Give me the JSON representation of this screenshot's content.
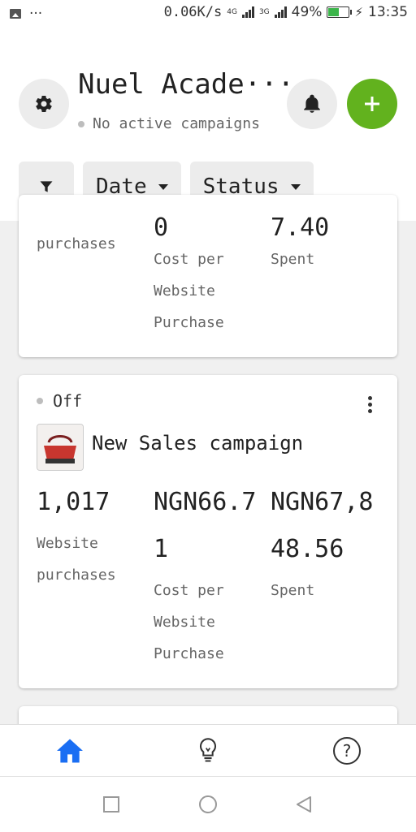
{
  "status_bar": {
    "notification_dots": "···",
    "speed": "0.06K/s",
    "net1": "4G",
    "net2": "3G",
    "battery": "49%",
    "time": "13:35"
  },
  "header": {
    "account_name": "Nuel Acade···",
    "subtitle": "No active campaigns",
    "add_icon": "plus-icon"
  },
  "filters": {
    "date_label": "Date",
    "status_label": "Status"
  },
  "cards": [
    {
      "metrics": [
        {
          "value": "0",
          "label_lines": [
            "purchases"
          ]
        },
        {
          "value": "",
          "label_lines": [
            "Cost per",
            "Website",
            "Purchase"
          ]
        },
        {
          "value": "7.40",
          "label_lines": [
            "Spent"
          ]
        }
      ]
    },
    {
      "status": "Off",
      "campaign_name": "New Sales campaign",
      "metrics": [
        {
          "value_lines": [
            "1,017"
          ],
          "label_lines": [
            "Website",
            "purchases"
          ]
        },
        {
          "value_lines": [
            "NGN66.7",
            "1"
          ],
          "label_lines": [
            "Cost per",
            "Website",
            "Purchase"
          ]
        },
        {
          "value_lines": [
            "NGN67,8",
            "48.56"
          ],
          "label_lines": [
            "Spent"
          ]
        }
      ]
    }
  ],
  "bottom_nav": {
    "items": [
      "home-icon",
      "lightbulb-icon",
      "help-icon"
    ],
    "accent": "#1a6ef3"
  },
  "colors": {
    "add_button": "#62b21e",
    "battery_fill": "#3bb54a"
  }
}
